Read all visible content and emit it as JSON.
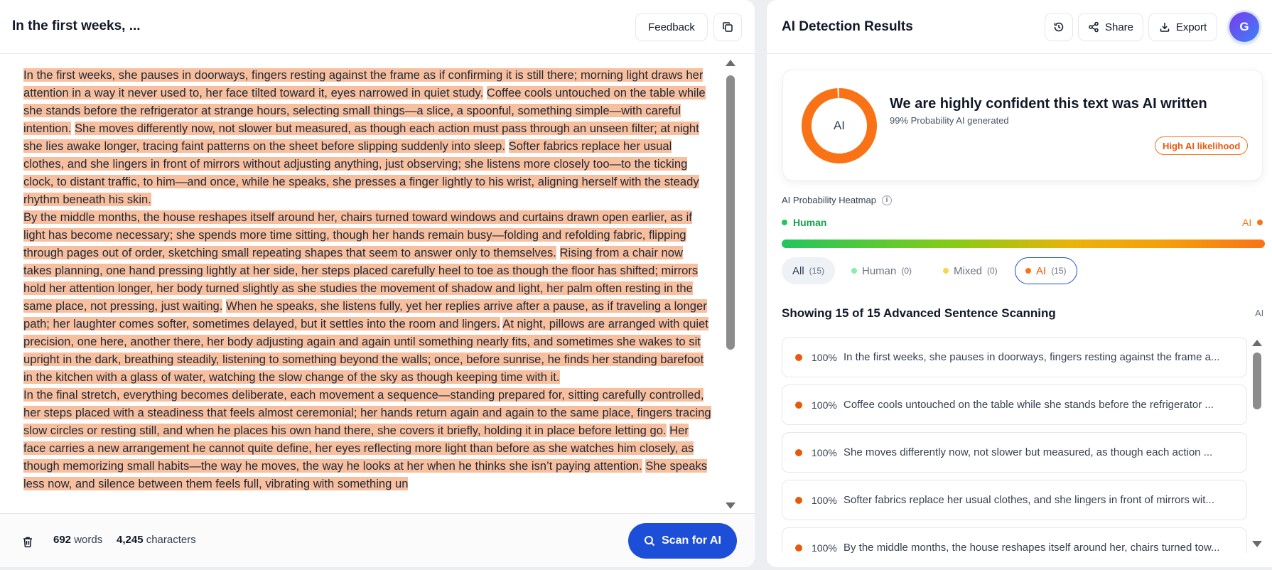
{
  "document": {
    "title": "In the first weeks, ...",
    "feedback_label": "Feedback",
    "paragraphs": [
      [
        "In the first weeks, she pauses in doorways, fingers resting against the frame as if confirming it is still there; morning light draws her attention in a way it never used to, her face tilted toward it, eyes narrowed in quiet study.",
        "Coffee cools un­touched on the table while she stands before the refrigerator at strange hours, selecting small things—a slice, a spoonful, something simple—with careful intention.",
        "She moves differently now, not slower but measured, as though each action must pass through an unseen filter; at night she lies awake longer, tracing faint patterns on the sheet before slipping sud­denly into sleep.",
        "Softer fabrics replace her usual clothes, and she lingers in front of mirrors without adjusting anything, just  observing; she listens more closely too—to the ticking clock, to distant traffic, to him—and once, while he speaks, she presses a finger lightly to his wrist, aligning herself with the steady rhythm beneath his skin."
      ],
      [
        "By the middle months, the house reshapes itself around her, chairs turned toward windows and curtains drawn open ear­lier, as if light has become necessary; she spends more time sitting, though her hands remain busy—folding and refolding fabric, flipping through pages out of order, sketching small repeating shapes that seem to answer only to themselves.",
        "Rising from a chair now takes planning, one hand pressing lightly at her side, her steps placed carefully heel to toe as though the floor has shifted; mirrors hold her attention longer, her body turned slightly as she studies the movement of shadow and light, her palm often resting in the same place, not pressing, just waiting.",
        "When he speaks, she listens fully, yet her replies arrive after a pause, as if traveling a longer path; her laughter comes softer, sometimes delayed, but it set­tles into the room and lingers.",
        "At night, pillows are arranged with quiet precision, one here, another there, her body adjust­ing again and again until something nearly fits, and sometimes she wakes to sit upright in the dark, breathing steadily, lis­tening to something beyond the walls; once, before sunrise, he finds her standing barefoot in the kitchen with a glass of water, watching the slow change of the sky as though keeping time with it."
      ],
      [
        "In the final stretch, everything becomes deliberate, each movement a sequence—standing prepared for, sitting carefully controlled, her steps placed with a steadiness that feels almost ceremonial; her hands return again and again to the same place, fingers tracing slow circles or resting still, and when he places his own hand there, she covers it briefly, holding it in place before letting go.",
        "Her face carries a new arrangement he cannot quite define, her eyes reflecting more light than be­fore as she watches him closely, as though memorizing small habits—the way he moves, the way he looks at her when he thinks she isn’t paying attention.",
        "She speaks less now, and silence between them feels full, vibrating with something un­"
      ]
    ],
    "word_count": "692",
    "words_label": "words",
    "char_count": "4,245",
    "chars_label": "characters",
    "scan_label": "Scan for AI"
  },
  "results": {
    "title": "AI Detection Results",
    "share_label": "Share",
    "export_label": "Export",
    "avatar_initial": "G",
    "donut_label": "AI",
    "ai_probability": 99,
    "verdict": "We are highly confident this text was AI written",
    "probability_text": "99% Probability AI generated",
    "badge": "High AI likelihood",
    "heatmap_label": "AI Probability Heatmap",
    "legend_human": "Human",
    "legend_ai": "AI",
    "tabs": [
      {
        "label": "All",
        "count": "(15)"
      },
      {
        "label": "Human",
        "count": "(0)"
      },
      {
        "label": "Mixed",
        "count": "(0)"
      },
      {
        "label": "AI",
        "count": "(15)"
      }
    ],
    "showing": "Showing 15 of 15 Advanced Sentence Scanning",
    "showing_tag": "AI",
    "sentences": [
      {
        "pct": "100%",
        "text": "In the first weeks, she pauses in doorways, fingers resting against the frame a..."
      },
      {
        "pct": "100%",
        "text": "Coffee cools untouched on the table while she stands before the refrigerator ..."
      },
      {
        "pct": "100%",
        "text": "She moves differently now, not slower but measured, as though each action ..."
      },
      {
        "pct": "100%",
        "text": "Softer fabrics replace her usual clothes, and she lingers in front of mirrors wit..."
      },
      {
        "pct": "100%",
        "text": "By the middle months, the house reshapes itself around her, chairs turned tow..."
      }
    ]
  },
  "colors": {
    "highlight": "#f8bf9f",
    "primary": "#1d4ed8",
    "ai_orange": "#f97316",
    "human_green": "#22c55e",
    "mixed_yellow": "#fcd34d"
  }
}
